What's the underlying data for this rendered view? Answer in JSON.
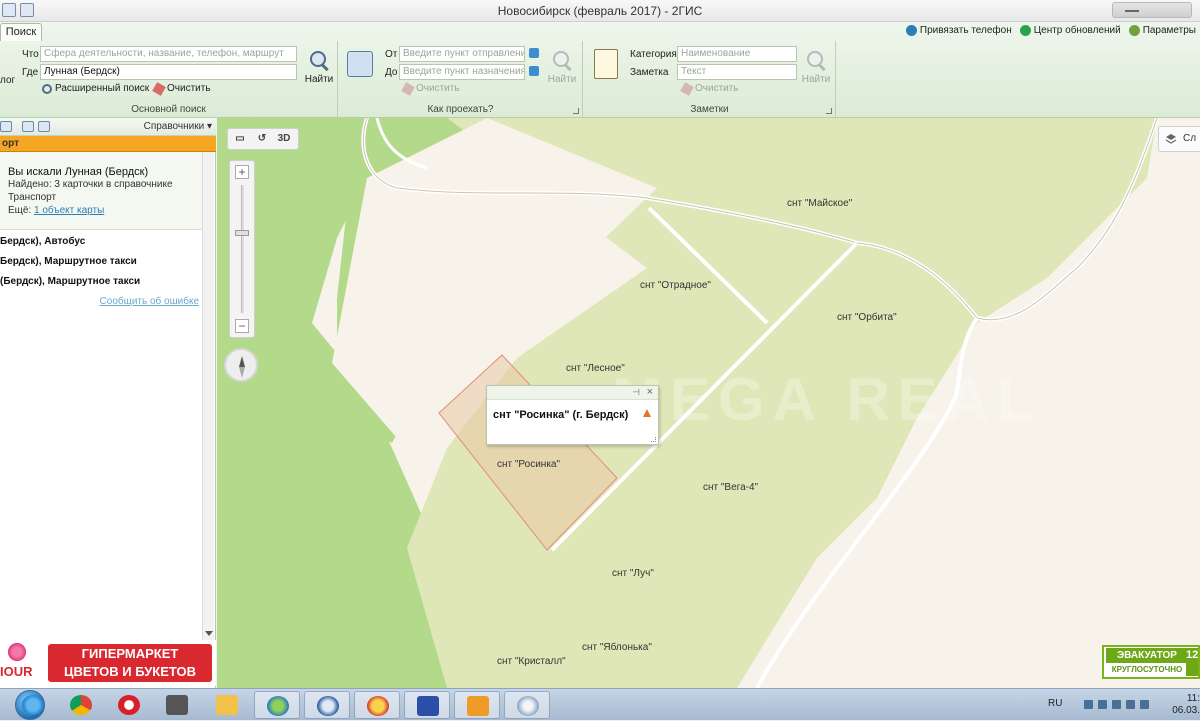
{
  "window": {
    "title": "Новосибирск (февраль 2017) - 2ГИС"
  },
  "ribbon": {
    "tab": "Поиск",
    "top_links": {
      "phone": "Привязать телефон",
      "updates": "Центр обновлений",
      "settings": "Параметры"
    },
    "main_search": {
      "what_label": "Что",
      "what_placeholder": "Сфера деятельности, название, телефон, маршрут",
      "where_label": "Где",
      "where_value": "Лунная (Бердск)",
      "left_fragment": "лог",
      "find_button": "Найти",
      "advanced": "Расширенный поиск",
      "clear": "Очистить",
      "caption": "Основной поиск"
    },
    "route": {
      "from_label": "От",
      "from_placeholder": "Введите пункт отправления",
      "to_label": "До",
      "to_placeholder": "Введите пункт назначения",
      "find_button": "Найти",
      "clear": "Очистить",
      "caption": "Как проехать?"
    },
    "notes": {
      "category_label": "Категория",
      "category_placeholder": "Наименование",
      "note_label": "Заметка",
      "note_placeholder": "Текст",
      "find_button": "Найти",
      "clear": "Очистить",
      "caption": "Заметки"
    }
  },
  "side": {
    "directories": "Справочники",
    "header": "орт",
    "info": {
      "searched": "Вы искали Лунная (Бердск)",
      "found": "Найдено: 3 карточки в справочнике",
      "category": "Транспорт",
      "more_label": "Ещё:",
      "more_link": "1 объект карты"
    },
    "results": [
      "Бердск), Автобус",
      "Бердск), Маршрутное такси",
      "(Бердск), Маршрутное такси"
    ],
    "report_error": "Сообщить об ошибке"
  },
  "ad": {
    "brand": "IOUR",
    "line1": "ГИПЕРМАРКЕТ",
    "line2": "ЦВЕТОВ И БУКЕТОВ"
  },
  "map": {
    "toolbar_3d": "3D",
    "layers_label": "Сл",
    "labels": [
      {
        "text": "снт \"Майское\""
      },
      {
        "text": "снт \"Отрадное\""
      },
      {
        "text": "снт \"Орбита\""
      },
      {
        "text": "снт \"Лесное\""
      },
      {
        "text": "снт \"Росинка\""
      },
      {
        "text": "снт \"Вега-4\""
      },
      {
        "text": "снт \"Луч\""
      },
      {
        "text": "снт \"Яблонька\""
      },
      {
        "text": "снт \"Кристалл\""
      }
    ],
    "popup": {
      "title": "снт \"Росинка\" (г. Бердск)"
    },
    "evac_ad": {
      "line1": "ЭВАКУАТОР",
      "line2": "КРУГЛОСУТОЧНО",
      "digits": "12"
    },
    "watermark": "MEGA REAL"
  },
  "taskbar": {
    "lang": "RU",
    "time": "11:",
    "date": "06.03."
  },
  "colors": {
    "forest": "#b4d98c",
    "field": "#dfe7b8",
    "road": "#ffffff",
    "plot_highlight": "#e78a7a",
    "accent": "#f5a623"
  }
}
